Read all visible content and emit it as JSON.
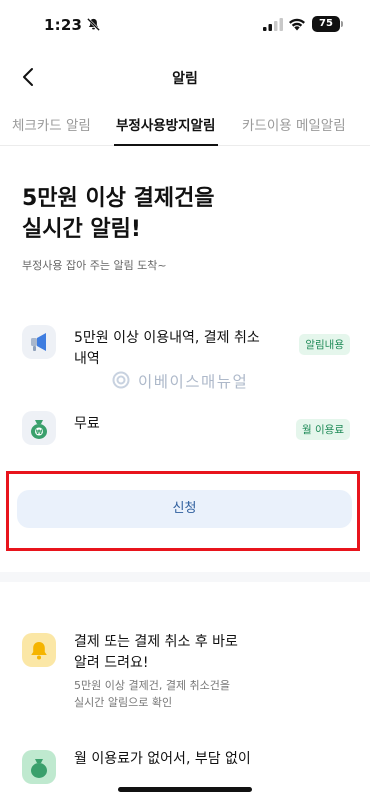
{
  "status_bar": {
    "time": "1:23",
    "battery": "75"
  },
  "nav": {
    "title": "알림"
  },
  "tabs": [
    {
      "label": "체크카드 알림",
      "active": false
    },
    {
      "label": "부정사용방지알림",
      "active": true
    },
    {
      "label": "카드이용 메일알림",
      "active": false
    }
  ],
  "hero": {
    "title_line1": "5만원 이상 결제건을",
    "title_line2": "실시간 알림!",
    "subtitle": "부정사용 잡아 주는 알림 도착~"
  },
  "info_rows": [
    {
      "text_line1": "5만원 이상 이용내역, 결제 취소",
      "text_line2": "내역",
      "badge": "알림내용",
      "icon": "megaphone-icon"
    },
    {
      "text_line1": "무료",
      "text_line2": "",
      "badge": "월 이용료",
      "icon": "money-bag-icon"
    }
  ],
  "watermark": "이베이스매뉴얼",
  "apply_button": "신청",
  "features": [
    {
      "title_line1": "결제 또는 결제 취소 후 바로",
      "title_line2": "알려 드려요!",
      "desc_line1": "5만원 이상 결제건, 결제 취소건을",
      "desc_line2": "실시간 알림으로 확인",
      "icon": "bell-icon",
      "icon_color": "#fbe7a6"
    },
    {
      "title_line1": "월 이용료가 없어서, 부담 없이",
      "icon": "money-bag-icon",
      "icon_color": "#bfe9cf"
    }
  ],
  "colors": {
    "accent_red": "#e8141c",
    "button_bg": "#eaf1fb",
    "button_text": "#2f5f9e",
    "badge_green": "#1e8a57"
  }
}
